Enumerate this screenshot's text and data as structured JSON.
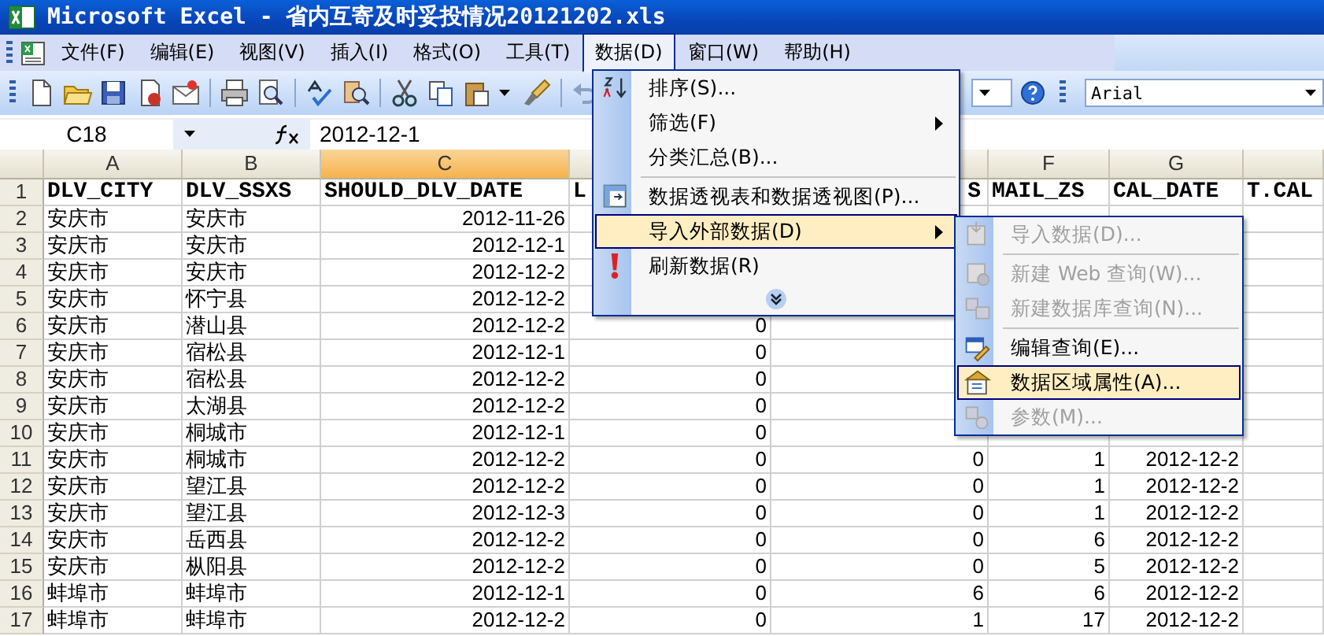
{
  "window": {
    "title": "Microsoft Excel - 省内互寄及时妥投情况20121202.xls"
  },
  "menu_bar": [
    {
      "label": "文件(F)",
      "selected": false
    },
    {
      "label": "编辑(E)",
      "selected": false
    },
    {
      "label": "视图(V)",
      "selected": false
    },
    {
      "label": "插入(I)",
      "selected": false
    },
    {
      "label": "格式(O)",
      "selected": false
    },
    {
      "label": "工具(T)",
      "selected": false
    },
    {
      "label": "数据(D)",
      "selected": true
    },
    {
      "label": "窗口(W)",
      "selected": false
    },
    {
      "label": "帮助(H)",
      "selected": false
    }
  ],
  "toolbar": {
    "font_name": "Arial"
  },
  "formula_bar": {
    "name_box": "C18",
    "formula": "2012-12-1"
  },
  "sheet": {
    "columns": [
      {
        "label": "A",
        "selected": false
      },
      {
        "label": "B",
        "selected": false
      },
      {
        "label": "C",
        "selected": true
      },
      {
        "selected": false
      },
      {
        "selected": false
      },
      {
        "label": "F",
        "selected": false
      },
      {
        "label": "G",
        "selected": false
      },
      {
        "selected": false
      }
    ],
    "header_row": {
      "number": "1",
      "cells": [
        "DLV_CITY",
        "DLV_SSXS",
        "SHOULD_DLV_DATE",
        "L",
        "S",
        "MAIL_ZS",
        "CAL_DATE",
        "T.CAL"
      ]
    },
    "rows": [
      {
        "number": "2",
        "cells": [
          "安庆市",
          "安庆市",
          "2012-11-26",
          null,
          null,
          null,
          null,
          null
        ]
      },
      {
        "number": "3",
        "cells": [
          "安庆市",
          "安庆市",
          "2012-12-1",
          null,
          null,
          null,
          null,
          null
        ]
      },
      {
        "number": "4",
        "cells": [
          "安庆市",
          "安庆市",
          "2012-12-2",
          null,
          null,
          null,
          null,
          null
        ]
      },
      {
        "number": "5",
        "cells": [
          "安庆市",
          "怀宁县",
          "2012-12-2",
          null,
          null,
          null,
          null,
          null
        ]
      },
      {
        "number": "6",
        "cells": [
          "安庆市",
          "潜山县",
          "2012-12-2",
          "0",
          null,
          null,
          null,
          null
        ]
      },
      {
        "number": "7",
        "cells": [
          "安庆市",
          "宿松县",
          "2012-12-1",
          "0",
          null,
          null,
          null,
          null
        ]
      },
      {
        "number": "8",
        "cells": [
          "安庆市",
          "宿松县",
          "2012-12-2",
          "0",
          null,
          null,
          null,
          null
        ]
      },
      {
        "number": "9",
        "cells": [
          "安庆市",
          "太湖县",
          "2012-12-2",
          "0",
          null,
          null,
          null,
          null
        ]
      },
      {
        "number": "10",
        "cells": [
          "安庆市",
          "桐城市",
          "2012-12-1",
          "0",
          null,
          null,
          null,
          null
        ]
      },
      {
        "number": "11",
        "cells": [
          "安庆市",
          "桐城市",
          "2012-12-2",
          "0",
          "0",
          "1",
          "2012-12-2",
          null
        ]
      },
      {
        "number": "12",
        "cells": [
          "安庆市",
          "望江县",
          "2012-12-2",
          "0",
          "0",
          "1",
          "2012-12-2",
          null
        ]
      },
      {
        "number": "13",
        "cells": [
          "安庆市",
          "望江县",
          "2012-12-3",
          "0",
          "0",
          "1",
          "2012-12-2",
          null
        ]
      },
      {
        "number": "14",
        "cells": [
          "安庆市",
          "岳西县",
          "2012-12-2",
          "0",
          "0",
          "6",
          "2012-12-2",
          null
        ]
      },
      {
        "number": "15",
        "cells": [
          "安庆市",
          "枞阳县",
          "2012-12-2",
          "0",
          "0",
          "5",
          "2012-12-2",
          null
        ]
      },
      {
        "number": "16",
        "cells": [
          "蚌埠市",
          "蚌埠市",
          "2012-12-1",
          "0",
          "6",
          "6",
          "2012-12-2",
          null
        ]
      },
      {
        "number": "17",
        "cells": [
          "蚌埠市",
          "蚌埠市",
          "2012-12-2",
          "0",
          "1",
          "17",
          "2012-12-2",
          null
        ]
      }
    ]
  },
  "data_menu": {
    "items": [
      {
        "kind": "item",
        "label": "排序(S)...",
        "selected": false,
        "disabled": false,
        "submenu": false
      },
      {
        "kind": "item",
        "label": "筛选(F)",
        "selected": false,
        "disabled": false,
        "submenu": true
      },
      {
        "kind": "item",
        "label": "分类汇总(B)...",
        "selected": false,
        "disabled": false,
        "submenu": false
      },
      {
        "kind": "separator"
      },
      {
        "kind": "item",
        "label": "数据透视表和数据透视图(P)...",
        "selected": false,
        "disabled": false,
        "submenu": false
      },
      {
        "kind": "item",
        "label": "导入外部数据(D)",
        "selected": true,
        "disabled": false,
        "submenu": true
      },
      {
        "kind": "item",
        "label": "刷新数据(R)",
        "selected": false,
        "disabled": false,
        "submenu": false
      },
      {
        "kind": "expand"
      }
    ]
  },
  "import_submenu": {
    "items": [
      {
        "kind": "item",
        "label": "导入数据(D)...",
        "selected": false,
        "disabled": true,
        "submenu": false
      },
      {
        "kind": "separator"
      },
      {
        "kind": "item",
        "label": "新建 Web 查询(W)...",
        "selected": false,
        "disabled": true,
        "submenu": false
      },
      {
        "kind": "item",
        "label": "新建数据库查询(N)...",
        "selected": false,
        "disabled": true,
        "submenu": false
      },
      {
        "kind": "separator"
      },
      {
        "kind": "item",
        "label": "编辑查询(E)...",
        "selected": false,
        "disabled": false,
        "submenu": false
      },
      {
        "kind": "item",
        "label": "数据区域属性(A)...",
        "selected": true,
        "disabled": false,
        "submenu": false
      },
      {
        "kind": "item",
        "label": "参数(M)...",
        "selected": false,
        "disabled": true,
        "submenu": false
      }
    ]
  }
}
